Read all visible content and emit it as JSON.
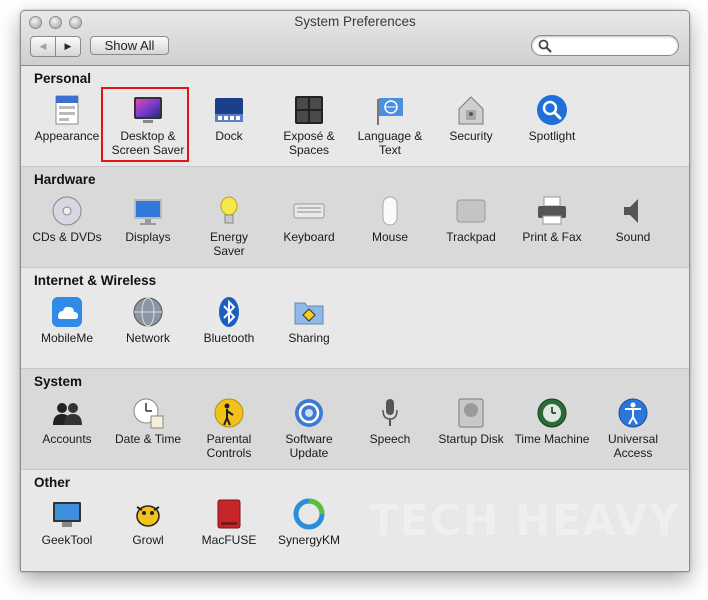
{
  "window": {
    "title": "System Preferences"
  },
  "toolbar": {
    "back_label": "◀",
    "forward_label": "▶",
    "show_all_label": "Show All",
    "search_value": "",
    "search_placeholder": ""
  },
  "sections": [
    {
      "title": "Personal",
      "items": [
        {
          "label": "Appearance",
          "icon": "appearance-icon"
        },
        {
          "label": "Desktop &\nScreen Saver",
          "icon": "desktop-screensaver-icon"
        },
        {
          "label": "Dock",
          "icon": "dock-icon"
        },
        {
          "label": "Exposé &\nSpaces",
          "icon": "expose-spaces-icon"
        },
        {
          "label": "Language &\nText",
          "icon": "language-text-icon"
        },
        {
          "label": "Security",
          "icon": "security-icon"
        },
        {
          "label": "Spotlight",
          "icon": "spotlight-icon"
        }
      ]
    },
    {
      "title": "Hardware",
      "items": [
        {
          "label": "CDs & DVDs",
          "icon": "cds-dvds-icon"
        },
        {
          "label": "Displays",
          "icon": "displays-icon"
        },
        {
          "label": "Energy\nSaver",
          "icon": "energy-saver-icon"
        },
        {
          "label": "Keyboard",
          "icon": "keyboard-icon"
        },
        {
          "label": "Mouse",
          "icon": "mouse-icon"
        },
        {
          "label": "Trackpad",
          "icon": "trackpad-icon"
        },
        {
          "label": "Print & Fax",
          "icon": "print-fax-icon"
        },
        {
          "label": "Sound",
          "icon": "sound-icon"
        }
      ]
    },
    {
      "title": "Internet & Wireless",
      "items": [
        {
          "label": "MobileMe",
          "icon": "mobileme-icon"
        },
        {
          "label": "Network",
          "icon": "network-icon"
        },
        {
          "label": "Bluetooth",
          "icon": "bluetooth-icon"
        },
        {
          "label": "Sharing",
          "icon": "sharing-icon"
        }
      ]
    },
    {
      "title": "System",
      "items": [
        {
          "label": "Accounts",
          "icon": "accounts-icon"
        },
        {
          "label": "Date & Time",
          "icon": "date-time-icon"
        },
        {
          "label": "Parental\nControls",
          "icon": "parental-controls-icon"
        },
        {
          "label": "Software\nUpdate",
          "icon": "software-update-icon"
        },
        {
          "label": "Speech",
          "icon": "speech-icon"
        },
        {
          "label": "Startup Disk",
          "icon": "startup-disk-icon"
        },
        {
          "label": "Time Machine",
          "icon": "time-machine-icon"
        },
        {
          "label": "Universal\nAccess",
          "icon": "universal-access-icon"
        }
      ]
    },
    {
      "title": "Other",
      "items": [
        {
          "label": "GeekTool",
          "icon": "geektool-icon"
        },
        {
          "label": "Growl",
          "icon": "growl-icon"
        },
        {
          "label": "MacFUSE",
          "icon": "macfuse-icon"
        },
        {
          "label": "SynergyKM",
          "icon": "synergykm-icon"
        }
      ]
    }
  ],
  "watermark": "TECH HEAVY",
  "colors": {
    "highlight": "#e01515",
    "spotlight": "#1e6fd9"
  }
}
